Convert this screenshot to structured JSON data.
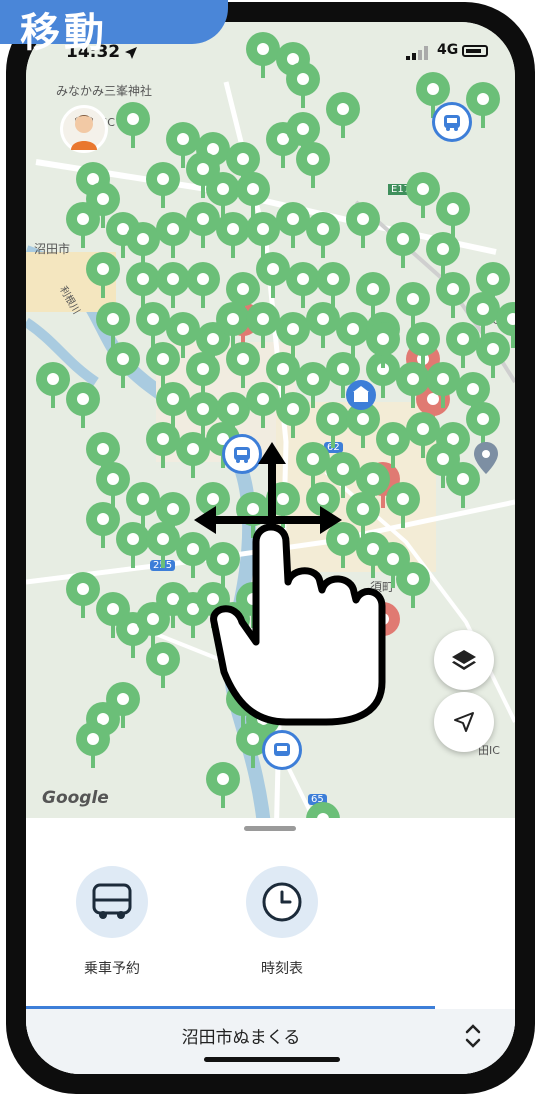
{
  "badge": {
    "label": "移動"
  },
  "status_bar": {
    "time": "14:32",
    "network": "4G"
  },
  "map": {
    "labels": {
      "shrine": "みなかみ三峯神社",
      "ic_top": "IC",
      "numata_city": "沼田市",
      "numata": "沼田",
      "machi_right": "町",
      "ic_right": "田IC",
      "suzu_machi": "須町",
      "e17": "E17",
      "route_62": "62",
      "route_255": "255",
      "route_65": "65",
      "ic_lower": "田IC",
      "river": "利根川"
    },
    "attribution": "Google",
    "icons": {
      "avatar": "user-avatar-icon",
      "bus_stop": "bus-icon",
      "layers": "layers-icon",
      "location": "navigation-arrow-icon",
      "poi": "location-pin-icon",
      "gesture": "hand-drag-icon"
    },
    "colors": {
      "pin": "#6bbf78",
      "pin_alt": "#e07a72",
      "accent": "#3d7ed8"
    }
  },
  "sheet": {
    "actions": [
      {
        "label": "乗車予約",
        "icon": "bus-icon"
      },
      {
        "label": "時刻表",
        "icon": "clock-icon"
      }
    ],
    "app_name": "沼田市ぬまくる",
    "toggle_icon": "chevron-up-down-icon"
  }
}
